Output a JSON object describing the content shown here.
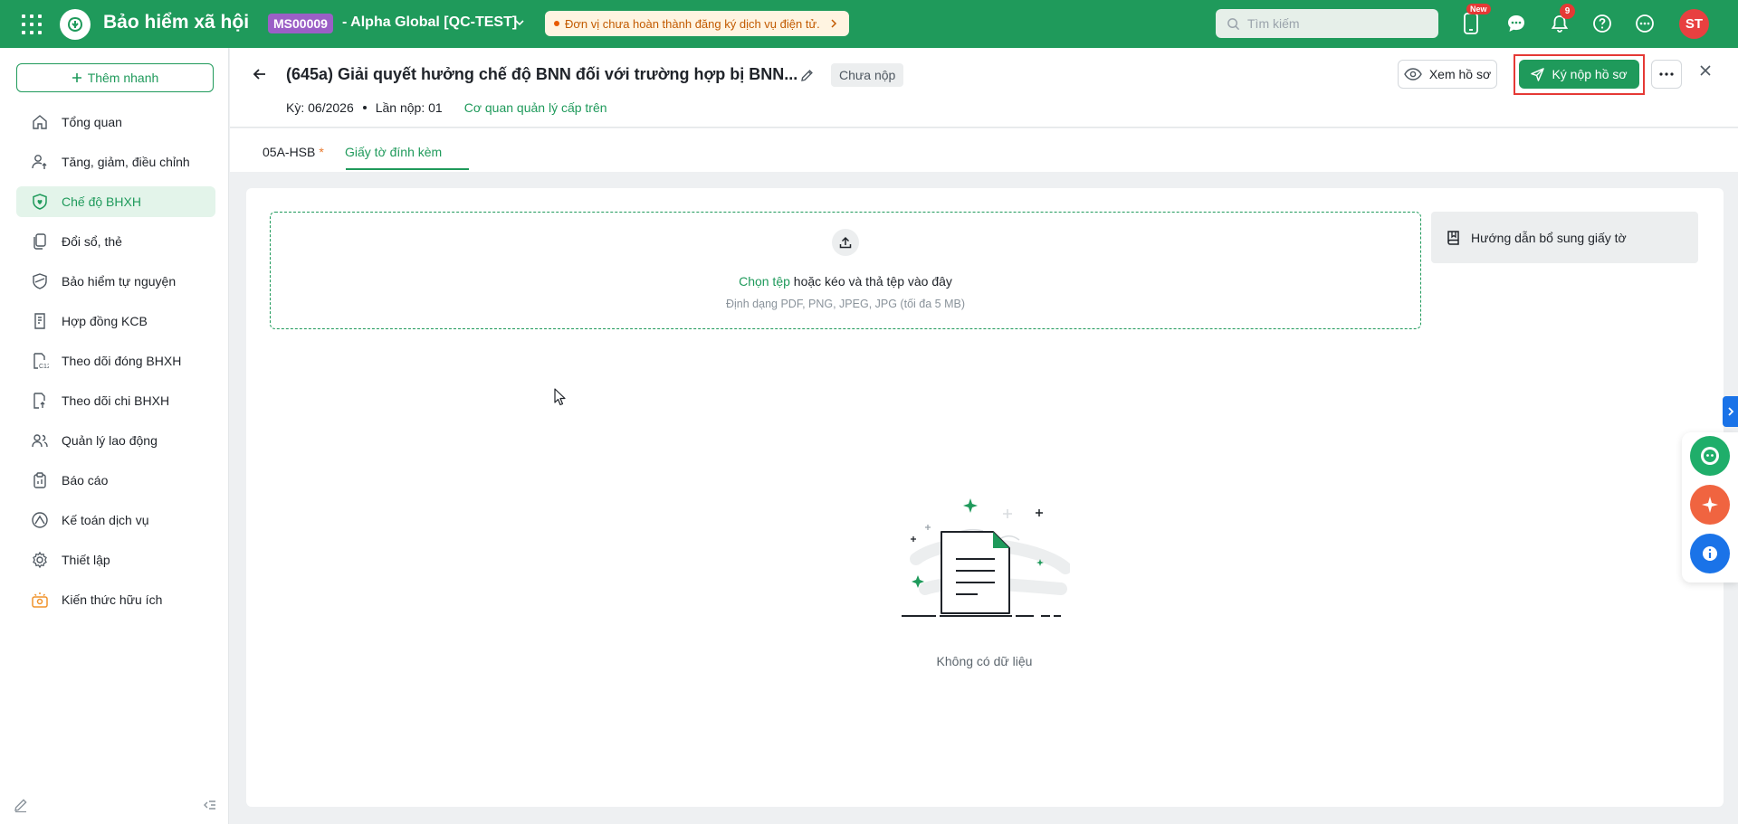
{
  "topbar": {
    "app_title": "Bảo hiểm xã hội",
    "org_code": "MS00009",
    "org_name": "- Alpha Global [QC-TEST]",
    "notice": "Đơn vị chưa hoàn thành đăng ký dịch vụ điện tử.",
    "search_placeholder": "Tìm kiếm",
    "new_badge": "New",
    "notification_count": "9",
    "avatar_initials": "ST"
  },
  "sidebar": {
    "add_button": "Thêm nhanh",
    "items": [
      {
        "label": "Tổng quan",
        "icon": "home-icon"
      },
      {
        "label": "Tăng, giảm, điều chỉnh",
        "icon": "user-adjust-icon"
      },
      {
        "label": "Chế độ BHXH",
        "icon": "shield-heart-icon",
        "active": true
      },
      {
        "label": "Đổi sổ, thẻ",
        "icon": "cards-icon"
      },
      {
        "label": "Bảo hiểm tự nguyện",
        "icon": "shield-icon"
      },
      {
        "label": "Hợp đồng KCB",
        "icon": "contract-icon"
      },
      {
        "label": "Theo dõi đóng BHXH",
        "icon": "doc-c12-icon"
      },
      {
        "label": "Theo dõi chi BHXH",
        "icon": "doc-payment-icon"
      },
      {
        "label": "Quản lý lao động",
        "icon": "users-icon"
      },
      {
        "label": "Báo cáo",
        "icon": "clipboard-icon"
      },
      {
        "label": "Kế toán dịch vụ",
        "icon": "accounting-icon"
      },
      {
        "label": "Thiết lập",
        "icon": "gear-icon"
      },
      {
        "label": "Kiến thức hữu ích",
        "icon": "knowledge-icon"
      }
    ]
  },
  "header": {
    "title": "(645a) Giải quyết hưởng chế độ BNN đối với trường hợp bị BNN...",
    "status": "Chưa nộp",
    "period": "Kỳ: 06/2026",
    "submission": "Lần nộp: 01",
    "agency_link": "Cơ quan quản lý cấp trên",
    "view_button": "Xem hồ sơ",
    "sign_button": "Ký nộp hồ sơ"
  },
  "tabs": [
    {
      "label": "05A-HSB",
      "required_mark": "*"
    },
    {
      "label": "Giấy tờ đính kèm",
      "active": true
    }
  ],
  "upload": {
    "choose_link": "Chọn tệp",
    "instruction": " hoặc kéo và thả tệp vào đây",
    "formats": "Định dạng PDF, PNG, JPEG, JPG (tối đa 5 MB)"
  },
  "guide_button": "Hướng dẫn bổ sung giấy tờ",
  "empty_state": "Không có dữ liệu",
  "colors": {
    "brand": "#1f9a5b",
    "highlight": "#e53935",
    "notice_bg": "#fff4e1",
    "org_badge": "#9b5fc6"
  }
}
